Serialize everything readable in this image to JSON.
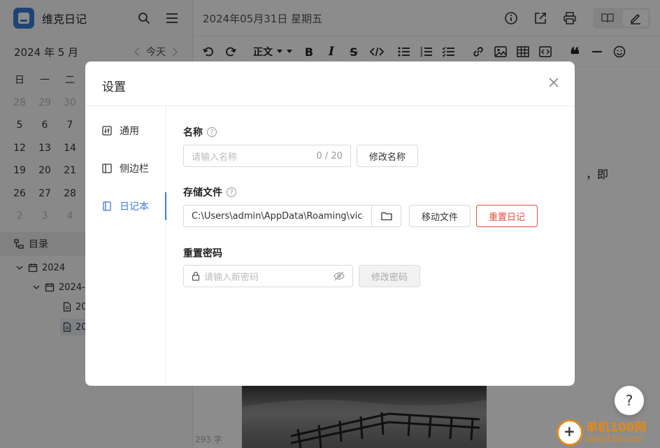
{
  "app": {
    "title": "维克日记"
  },
  "sidebar": {
    "month_label": "2024 年 5 月",
    "today_label": "今天",
    "weekdays": [
      "日",
      "一",
      "二"
    ],
    "calendar_rows": [
      [
        "28",
        "29",
        "30"
      ],
      [
        "5",
        "6",
        "7"
      ],
      [
        "12",
        "13",
        "14"
      ],
      [
        "19",
        "20",
        "21"
      ],
      [
        "26",
        "27",
        "28"
      ],
      [
        "2",
        "3",
        "4"
      ]
    ],
    "directory_label": "目录",
    "tree": {
      "year": "2024",
      "month": "2024-",
      "entry1": "20",
      "entry2": "20"
    }
  },
  "main": {
    "date_title": "2024年05月31日 星期五",
    "toolbar": {
      "paragraph_label": "正文"
    },
    "editor_visible_text": "，即",
    "word_count": "293 字"
  },
  "help": {
    "label": "?"
  },
  "watermark": {
    "line1": "单机100网",
    "line2": "danji100.com"
  },
  "settings": {
    "title": "设置",
    "nav": [
      {
        "label": "通用"
      },
      {
        "label": "侧边栏"
      },
      {
        "label": "日记本"
      }
    ],
    "name": {
      "label": "名称",
      "placeholder": "请输入名称",
      "counter": "0 / 20",
      "button": "修改名称"
    },
    "storage": {
      "label": "存储文件",
      "path": "C:\\Users\\admin\\AppData\\Roaming\\vic-c",
      "move_button": "移动文件",
      "reset_button": "重置日记"
    },
    "password": {
      "label": "重置密码",
      "placeholder": "请输入新密码",
      "button": "修改密码"
    }
  },
  "colors": {
    "accent": "#3a7bd5",
    "danger": "#e74c3c",
    "watermark": "#e08a1e"
  }
}
